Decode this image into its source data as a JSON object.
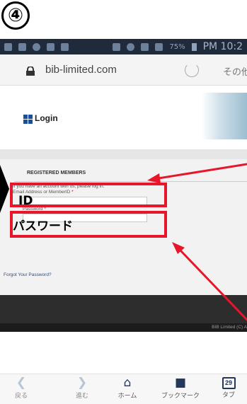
{
  "annotation": {
    "step_number": "④",
    "id_label": "ID",
    "password_label": "パスワード"
  },
  "status_bar": {
    "battery": "75%",
    "time": "PM 10:2"
  },
  "browser": {
    "url": "bib-limited.com",
    "other_menu": "その他"
  },
  "page": {
    "login_title": "Login",
    "section_title": "REGISTERED MEMBERS",
    "intro_text": "If you have an account with us, please log in.",
    "id_field_label": "Email Address or MemberID",
    "password_field_label": "Password",
    "required_mark": "*",
    "forgot_password": "Forgot Your Password?",
    "copyright": "BIB Limited (C) A"
  },
  "bottom_nav": {
    "back": "戻る",
    "forward": "進む",
    "home": "ホーム",
    "bookmarks": "ブックマーク",
    "tabs": "タブ",
    "tab_count": "29"
  },
  "colors": {
    "annotation_red": "#e8162b",
    "status_bar_bg": "#1f2a3a",
    "footer_bg": "#2d2d2d",
    "link_blue": "#2a4f8f"
  }
}
